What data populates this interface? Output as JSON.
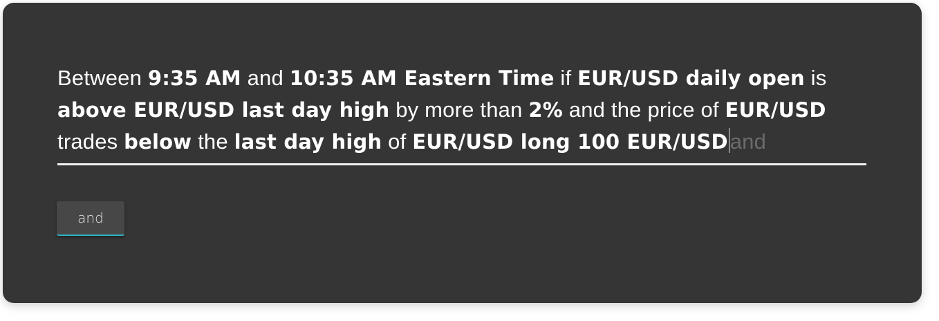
{
  "sentence": {
    "line1": {
      "t1": "Between ",
      "t2": "9:35 AM",
      "t3": " and ",
      "t4": "10:35 AM Eastern Time",
      "t5": " if ",
      "t6": "EUR/USD daily open",
      "t7": " is"
    },
    "line2": {
      "t1": "above EUR/USD last day high",
      "t2": " by more than ",
      "t3": "2%",
      "t4": " and the price of ",
      "t5": "EUR/USD"
    },
    "line3": {
      "t1": "trades ",
      "t2": "below",
      "t3": " the ",
      "t4": "last day high",
      "t5": " of ",
      "t6": "EUR/USD long 100 EUR/USD"
    },
    "ghost_suggestion": "and"
  },
  "suggestions": {
    "button_label": "and"
  },
  "colors": {
    "card_background": "#353535",
    "text": "#ffffff",
    "ghost_text": "#6b6b6b",
    "accent": "#2fb3c9"
  }
}
